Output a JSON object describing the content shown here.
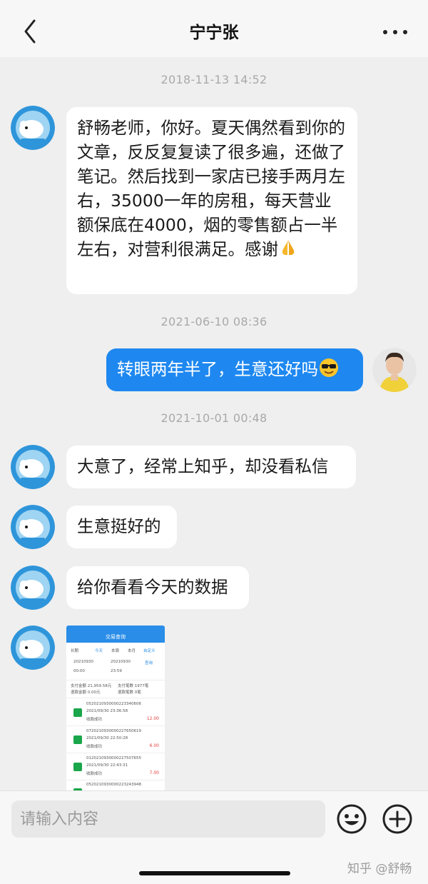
{
  "header": {
    "title": "宁宁张"
  },
  "messages": {
    "time1": "2018-11-13 14:52",
    "m1_text": "舒畅老师，你好。夏天偶然看到你的文章，反反复复读了很多遍，还做了笔记。然后找到一家店已接手两月左右，35000一年的房租，每天营业额保底在4000，烟的零售额占一半左右，对营利很满足。感谢",
    "time2": "2021-06-10 08:36",
    "m2_text": "转眼两年半了，生意还好吗",
    "time3": "2021-10-01 00:48",
    "m3_text": "大意了，经常上知乎，却没看私信",
    "m4_text": "生意挺好的",
    "m5_text": "给你看看今天的数据"
  },
  "thumbnail": {
    "title": "交易查询",
    "tabs": [
      "长期",
      "今天",
      "本周",
      "本月",
      "自定义"
    ],
    "date1": "20210930",
    "date2": "20210930",
    "time_start": "00:00",
    "time_end": "23:59",
    "query": "查询",
    "stats": [
      "支付金额 21,959.58元",
      "支付笔数 1977笔",
      "退款金额 0.00元",
      "退款笔数 0笔"
    ],
    "orders": [
      {
        "id": "0520210930000223340606",
        "time": "2021/09/30 23:36:58",
        "status": "收款成功",
        "amount": "12.00"
      },
      {
        "id": "0720210930000227650619",
        "time": "2021/09/30 22:50:28",
        "status": "收款成功",
        "amount": "6.00"
      },
      {
        "id": "0120210930000227507655",
        "time": "2021/09/30 22:43:31",
        "status": "收款成功",
        "amount": "7.00"
      },
      {
        "id": "0520210930000223243948",
        "time": "",
        "status": "",
        "amount": ""
      }
    ]
  },
  "input": {
    "placeholder": "请输入内容"
  },
  "watermark": "知乎 @舒畅",
  "colors": {
    "background": "#efefef",
    "self_bubble": "#1e88f0",
    "other_bubble": "#ffffff",
    "timestamp": "#a9a9a9"
  },
  "icons": [
    "back-chevron-icon",
    "more-dots-icon",
    "emoji-icon",
    "plus-icon",
    "pray-emoji-icon",
    "sunglasses-emoji-icon"
  ]
}
